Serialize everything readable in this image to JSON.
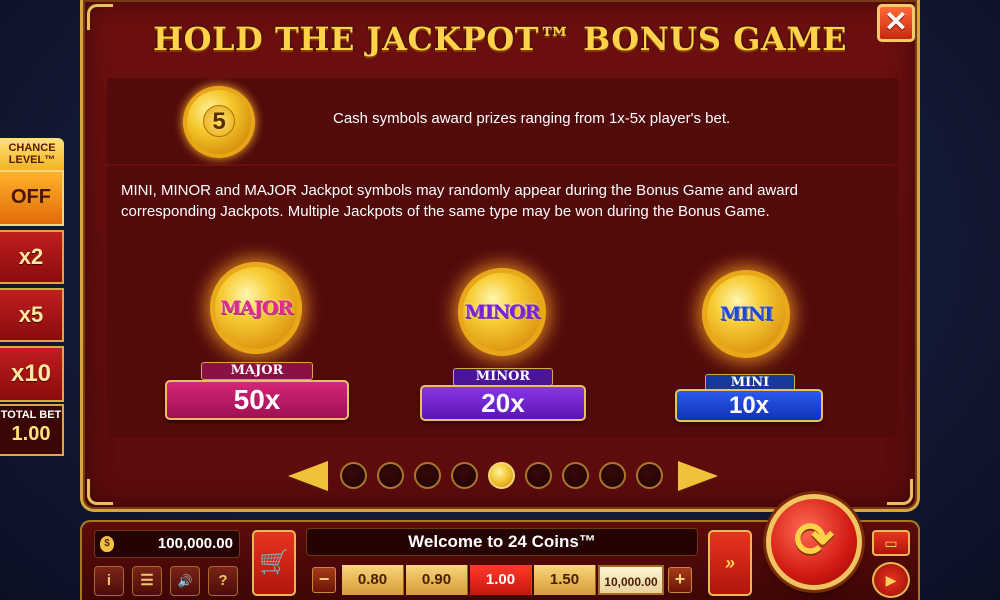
{
  "title": "HOLD THE JACKPOT™ BONUS GAME",
  "close_icon": "✕",
  "cash_coin_value": "5",
  "cash_text": "Cash symbols award prizes ranging from 1x-5x player's bet.",
  "jackpot_text": "MINI, MINOR and MAJOR Jackpot symbols may randomly appear during the Bonus Game and award corresponding Jackpots. Multiple Jackpots of the same type may be won during the Bonus Game.",
  "jackpots": {
    "major": {
      "coin_label": "MAJOR",
      "tag": "MAJOR",
      "value": "50x",
      "color": "#d42876"
    },
    "minor": {
      "coin_label": "MINOR",
      "tag": "MINOR",
      "value": "20x",
      "color": "#8a34e8"
    },
    "mini": {
      "coin_label": "MINI",
      "tag": "MINI",
      "value": "10x",
      "color": "#2b5af0"
    }
  },
  "pager": {
    "total": 9,
    "active_index": 4
  },
  "side": {
    "chance_label": "CHANCE LEVEL™",
    "buttons": [
      "OFF",
      "x2",
      "x5",
      "x10"
    ],
    "total_bet_label": "TOTAL BET",
    "total_bet_value": "1.00"
  },
  "bottom": {
    "balance": "100,000.00",
    "welcome": "Welcome to 24 Coins™",
    "bets": [
      "0.80",
      "0.90",
      "1.00",
      "1.50",
      "10,000.00"
    ],
    "selected_bet": "1.00",
    "minus": "−",
    "plus": "+",
    "info_icon": "i",
    "menu_icon": "☰",
    "sound_icon": "🔊",
    "help_icon": "?",
    "cart_icon": "🛒",
    "turbo_icon": "»",
    "spin_icon": "⟳",
    "exit_icon": "▭",
    "autoplay_icon": "▶"
  },
  "colors": {
    "panel": "#6d0f0f",
    "gold": "#ffd24a",
    "accent_red": "#c8150c"
  }
}
